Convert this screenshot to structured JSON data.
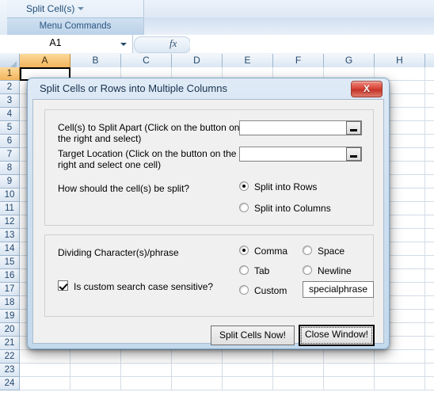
{
  "ribbon": {
    "tab_label": "Split Cell(s)",
    "group_caption": "Menu Commands",
    "caret_icon": "chevron-down-icon"
  },
  "formula_bar": {
    "name_box_value": "A1",
    "fx_label": "fx",
    "formula_value": ""
  },
  "sheet": {
    "columns": [
      "A",
      "B",
      "C",
      "D",
      "E",
      "F",
      "G",
      "H"
    ],
    "rows": [
      1,
      2,
      3,
      4,
      5,
      6,
      7,
      8,
      9,
      10,
      11,
      12,
      13,
      14,
      15,
      16,
      17,
      18,
      19,
      20,
      21,
      22,
      23,
      24
    ],
    "active_cell": "A1",
    "selected_column": "A",
    "selected_row": 1
  },
  "dialog": {
    "title": "Split Cells or Rows into Multiple Columns",
    "close_button_label": "X",
    "source_group": {
      "cells_label": "Cell(s) to Split Apart (Click on the button on the right and select)",
      "cells_value": "",
      "cells_picker_icon": "range-picker-icon",
      "target_label": "Target Location (Click on the button on the right and select one cell)",
      "target_value": "",
      "target_picker_icon": "range-picker-icon",
      "split_question": "How should the cell(s) be split?",
      "split_options": [
        {
          "label": "Split into Rows",
          "selected": true
        },
        {
          "label": "Split into Columns",
          "selected": false
        }
      ]
    },
    "divider_group": {
      "heading": "Dividing Character(s)/phrase",
      "case_sensitive_label": "Is custom search case sensitive?",
      "case_sensitive_checked": true,
      "options": [
        {
          "label": "Comma",
          "selected": true
        },
        {
          "label": "Space",
          "selected": false
        },
        {
          "label": "Tab",
          "selected": false
        },
        {
          "label": "Newline",
          "selected": false
        },
        {
          "label": "Custom",
          "selected": false
        }
      ],
      "custom_value": "specialphrase"
    },
    "actions": {
      "split_label": "Split Cells Now!",
      "close_label": "Close Window!",
      "focused": "close"
    }
  }
}
